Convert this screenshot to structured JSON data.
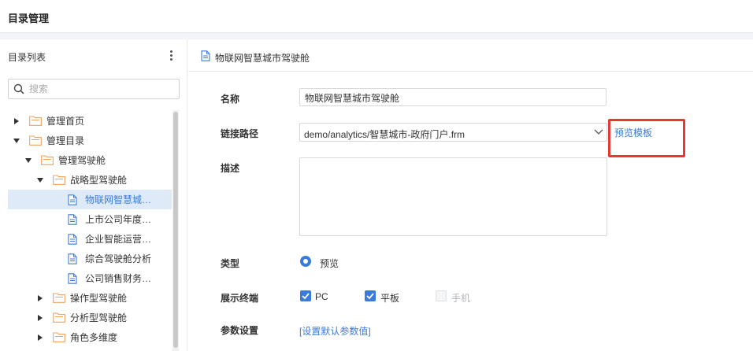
{
  "header": {
    "title": "目录管理"
  },
  "sidebar": {
    "title": "目录列表",
    "menu_icon": "more-vertical-icon",
    "search": {
      "placeholder": "搜索",
      "value": ""
    },
    "tree": [
      {
        "label": "管理首页",
        "type": "folder",
        "level": 0,
        "expanded": false
      },
      {
        "label": "管理目录",
        "type": "folder",
        "level": 0,
        "expanded": true
      },
      {
        "label": "管理驾驶舱",
        "type": "folder",
        "level": 1,
        "expanded": true
      },
      {
        "label": "战略型驾驶舱",
        "type": "folder",
        "level": 2,
        "expanded": true
      },
      {
        "label": "物联网智慧城…",
        "type": "file",
        "level": 3,
        "selected": true
      },
      {
        "label": "上市公司年度…",
        "type": "file",
        "level": 3
      },
      {
        "label": "企业智能运营…",
        "type": "file",
        "level": 3
      },
      {
        "label": "综合驾驶舱分析",
        "type": "file",
        "level": 3
      },
      {
        "label": "公司销售财务…",
        "type": "file",
        "level": 3
      },
      {
        "label": "操作型驾驶舱",
        "type": "folder",
        "level": 2,
        "expanded": false
      },
      {
        "label": "分析型驾驶舱",
        "type": "folder",
        "level": 2,
        "expanded": false
      },
      {
        "label": "角色多维度",
        "type": "folder",
        "level": 2,
        "expanded": false
      }
    ]
  },
  "main": {
    "title": "物联网智慧城市驾驶舱",
    "form": {
      "name_label": "名称",
      "name_value": "物联网智慧城市驾驶舱",
      "path_label": "链接路径",
      "path_value": "demo/analytics/智慧城市-政府门户.frm",
      "preview_template": "预览模板",
      "desc_label": "描述",
      "desc_value": "",
      "type_label": "类型",
      "type_option": "预览",
      "terminal_label": "展示终端",
      "terminals": [
        {
          "label": "PC",
          "checked": true,
          "disabled": false
        },
        {
          "label": "平板",
          "checked": true,
          "disabled": false
        },
        {
          "label": "手机",
          "checked": false,
          "disabled": true
        }
      ],
      "param_label": "参数设置",
      "param_link": "[设置默认参数值]"
    }
  },
  "colors": {
    "accent": "#3a7ad9",
    "folder": "#f0a35e",
    "highlight": "#e53935",
    "selected_bg": "#dfeaf9"
  }
}
